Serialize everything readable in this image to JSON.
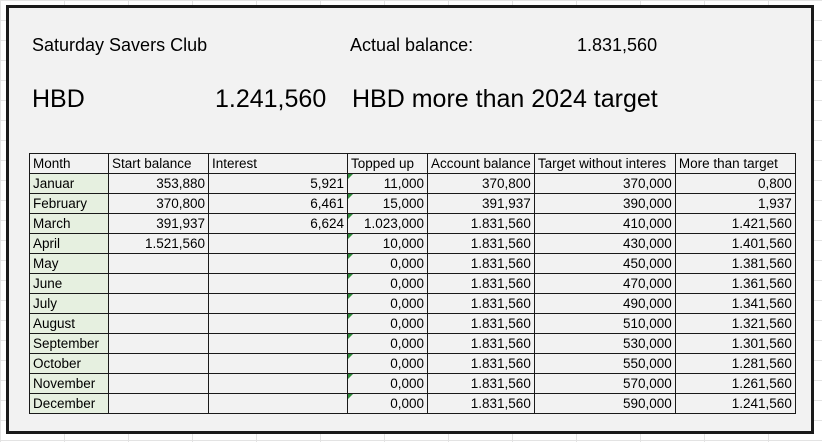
{
  "title": "Saturday Savers Club",
  "actual_balance_label": "Actual balance:",
  "actual_balance_value": "1.831,560",
  "currency": "HBD",
  "difference_value": "1.241,560",
  "difference_text": "HBD more than 2024 target",
  "columns": [
    "Month",
    "Start balance",
    "Interest",
    "Topped up",
    "Account balance",
    "Target without interes",
    "More than target"
  ],
  "rows": [
    {
      "month": "Januar",
      "start": "353,880",
      "interest": "5,921",
      "topped": "11,000",
      "account": "370,800",
      "target": "370,000",
      "more": "0,800"
    },
    {
      "month": "February",
      "start": "370,800",
      "interest": "6,461",
      "topped": "15,000",
      "account": "391,937",
      "target": "390,000",
      "more": "1,937"
    },
    {
      "month": "March",
      "start": "391,937",
      "interest": "6,624",
      "topped": "1.023,000",
      "account": "1.831,560",
      "target": "410,000",
      "more": "1.421,560"
    },
    {
      "month": "April",
      "start": "1.521,560",
      "interest": "",
      "topped": "10,000",
      "account": "1.831,560",
      "target": "430,000",
      "more": "1.401,560"
    },
    {
      "month": "May",
      "start": "",
      "interest": "",
      "topped": "0,000",
      "account": "1.831,560",
      "target": "450,000",
      "more": "1.381,560"
    },
    {
      "month": "June",
      "start": "",
      "interest": "",
      "topped": "0,000",
      "account": "1.831,560",
      "target": "470,000",
      "more": "1.361,560"
    },
    {
      "month": "July",
      "start": "",
      "interest": "",
      "topped": "0,000",
      "account": "1.831,560",
      "target": "490,000",
      "more": "1.341,560"
    },
    {
      "month": "August",
      "start": "",
      "interest": "",
      "topped": "0,000",
      "account": "1.831,560",
      "target": "510,000",
      "more": "1.321,560"
    },
    {
      "month": "September",
      "start": "",
      "interest": "",
      "topped": "0,000",
      "account": "1.831,560",
      "target": "530,000",
      "more": "1.301,560"
    },
    {
      "month": "October",
      "start": "",
      "interest": "",
      "topped": "0,000",
      "account": "1.831,560",
      "target": "550,000",
      "more": "1.281,560"
    },
    {
      "month": "November",
      "start": "",
      "interest": "",
      "topped": "0,000",
      "account": "1.831,560",
      "target": "570,000",
      "more": "1.261,560"
    },
    {
      "month": "December",
      "start": "",
      "interest": "",
      "topped": "0,000",
      "account": "1.831,560",
      "target": "590,000",
      "more": "1.241,560"
    }
  ],
  "colors": {
    "frame_border": "#1a1a1a",
    "sheet_background": "#f2f2f2",
    "month_cell_tint": "#e6f0e0",
    "cell_flag": "#2e8b3a"
  }
}
